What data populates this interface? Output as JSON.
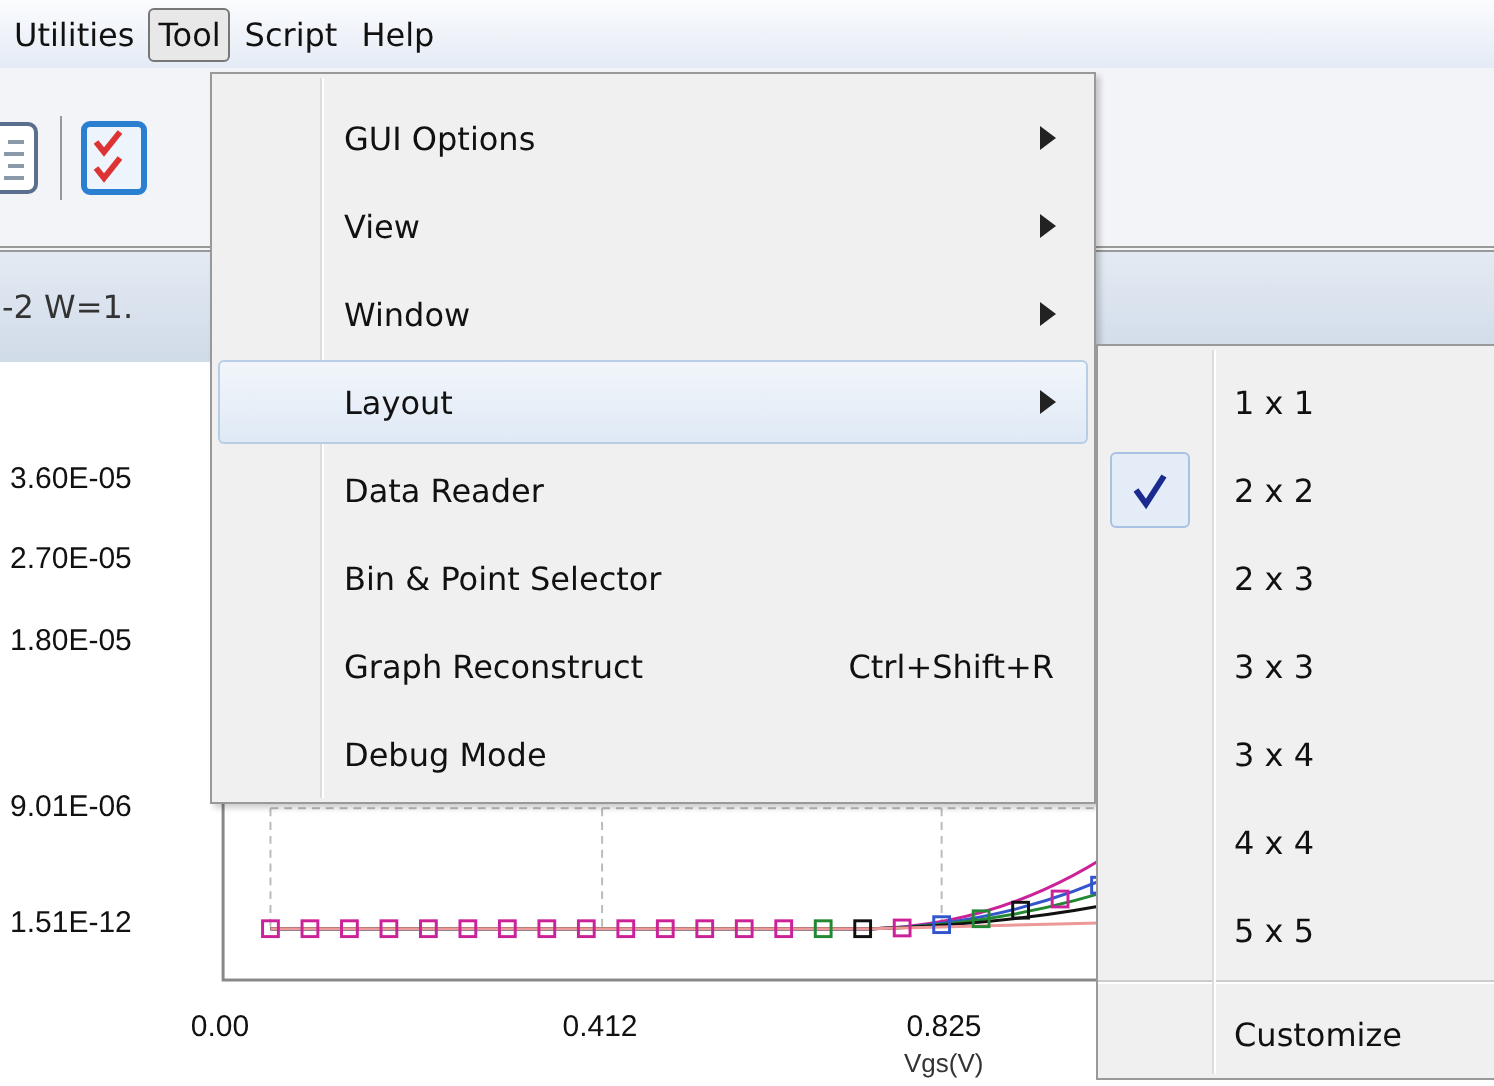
{
  "menu_bar": [
    {
      "label": "Utilities",
      "selected": false
    },
    {
      "label": "Tool",
      "selected": true
    },
    {
      "label": "Script",
      "selected": false
    },
    {
      "label": "Help",
      "selected": false
    }
  ],
  "panel_title": "-2 W=1.",
  "chart": {
    "y_tick_labels": [
      "3.60E-05",
      "2.70E-05",
      "1.80E-05",
      "9.01E-06",
      "1.51E-12"
    ],
    "x_tick_labels": [
      "0.00",
      "0.412",
      "0.825"
    ],
    "x_axis_label": "Vgs(V)"
  },
  "tool_menu": [
    {
      "label": "GUI Options",
      "submenu": true,
      "selected": false
    },
    {
      "label": "View",
      "submenu": true,
      "selected": false
    },
    {
      "label": "Window",
      "submenu": true,
      "selected": false
    },
    {
      "label": "Layout",
      "submenu": true,
      "selected": true
    },
    {
      "label": "Data Reader",
      "submenu": false,
      "selected": false
    },
    {
      "label": "Bin & Point Selector",
      "submenu": false,
      "selected": false
    },
    {
      "label": "Graph Reconstruct",
      "shortcut": "Ctrl+Shift+R",
      "submenu": false,
      "selected": false
    },
    {
      "label": "Debug Mode",
      "submenu": false,
      "selected": false
    }
  ],
  "layout_submenu": [
    {
      "kind": "option",
      "label": "1 x 1",
      "checked": false
    },
    {
      "kind": "option",
      "label": "2 x 2",
      "checked": true
    },
    {
      "kind": "option",
      "label": "2 x 3",
      "checked": false
    },
    {
      "kind": "option",
      "label": "3 x 3",
      "checked": false
    },
    {
      "kind": "option",
      "label": "3 x 4",
      "checked": false
    },
    {
      "kind": "option",
      "label": "4 x 4",
      "checked": false
    },
    {
      "kind": "option",
      "label": "5 x 5",
      "checked": false
    },
    {
      "kind": "separator"
    },
    {
      "kind": "option",
      "label": "Customize",
      "checked": false
    }
  ]
}
